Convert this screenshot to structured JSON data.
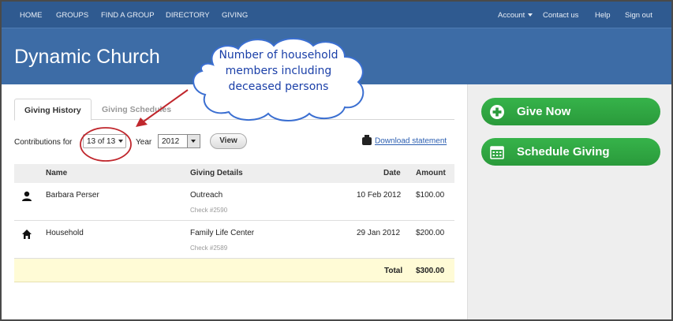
{
  "nav": {
    "left": [
      "HOME",
      "GROUPS",
      "FIND A GROUP",
      "DIRECTORY",
      "GIVING"
    ],
    "account": "Account",
    "contact": "Contact us",
    "help": "Help",
    "signout": "Sign out"
  },
  "brand": "Dynamic Church",
  "tabs": {
    "history": "Giving History",
    "schedules": "Giving Schedules"
  },
  "filters": {
    "contributions_label": "Contributions for",
    "members_value": "13 of 13",
    "year_label": "Year",
    "year_value": "2012",
    "view_button": "View",
    "download": "Download statement"
  },
  "table": {
    "headers": {
      "name": "Name",
      "details": "Giving Details",
      "date": "Date",
      "amount": "Amount"
    },
    "rows": [
      {
        "name": "Barbara Perser",
        "detail": "Outreach",
        "check": "Check #2590",
        "date": "10 Feb 2012",
        "amount": "$100.00",
        "icon": "person-icon"
      },
      {
        "name": "Household",
        "detail": "Family Life Center",
        "check": "Check #2589",
        "date": "29 Jan 2012",
        "amount": "$200.00",
        "icon": "house-icon"
      }
    ],
    "total_label": "Total",
    "total_value": "$300.00"
  },
  "sidebar": {
    "give_now": "Give Now",
    "schedule_giving": "Schedule Giving"
  },
  "callout": {
    "line1": "Number of household",
    "line2": "members including",
    "line3": "deceased persons"
  },
  "colors": {
    "nav_bg": "#2f5a90",
    "header_bg": "#3d6ca6",
    "green": "#2fa842",
    "callout_outline": "#3b6fd1",
    "annotation_red": "#c0272d"
  }
}
